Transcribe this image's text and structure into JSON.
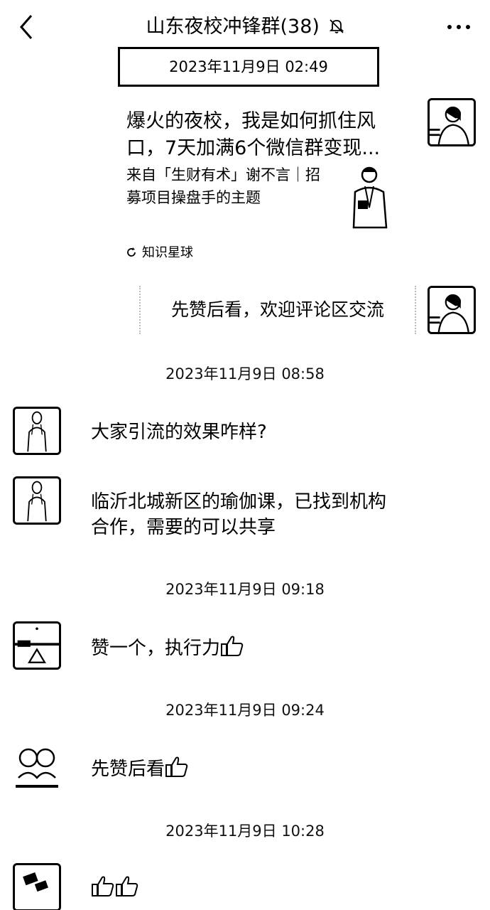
{
  "header": {
    "back_icon": "chevron-left-icon",
    "title": "山东夜校冲锋群(38)",
    "mute_icon": "bell-off-icon",
    "more_icon": "more-dots-icon"
  },
  "messages": [
    {
      "time": "2023年11月9日 02:49",
      "card": {
        "title": "爆火的夜校，我是如何抓住风口，7天加满6个微信群变现...",
        "desc": "来自「生财有术」谢不言｜招募项目操盘手的主题",
        "source": "知识星球"
      }
    },
    {
      "text": "先赞后看，欢迎评论区交流"
    },
    {
      "time": "2023年11月9日 08:58"
    },
    {
      "text": "大家引流的效果咋样?"
    },
    {
      "text": "临沂北城新区的瑜伽课，已找到机构合作，需要的可以共享"
    },
    {
      "time": "2023年11月9日 09:18"
    },
    {
      "text": "赞一个，执行力"
    },
    {
      "time": "2023年11月9日 09:24"
    },
    {
      "text": "先赞后看"
    },
    {
      "time": "2023年11月9日 10:28"
    }
  ],
  "icons": {
    "thumbs_up": "thumbs-up-icon"
  }
}
